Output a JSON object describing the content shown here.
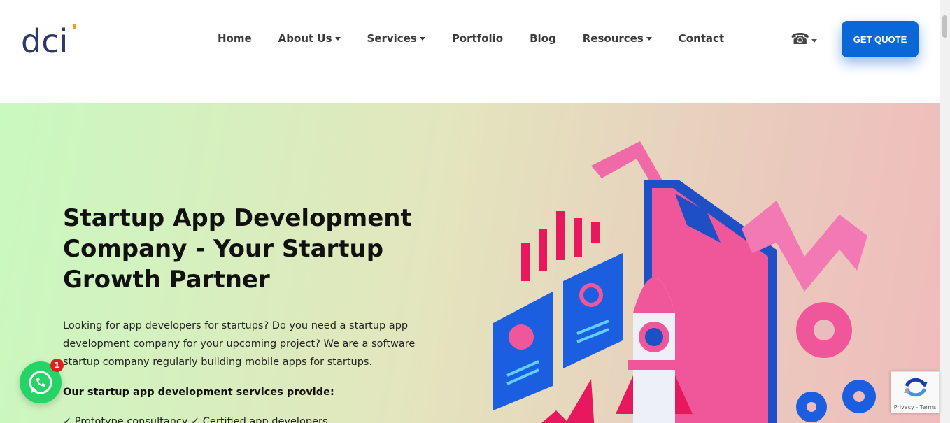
{
  "header": {
    "logo_text": "dci",
    "nav": [
      {
        "label": "Home",
        "has_dropdown": false
      },
      {
        "label": "About Us",
        "has_dropdown": true
      },
      {
        "label": "Services",
        "has_dropdown": true
      },
      {
        "label": "Portfolio",
        "has_dropdown": false
      },
      {
        "label": "Blog",
        "has_dropdown": false
      },
      {
        "label": "Resources",
        "has_dropdown": true
      },
      {
        "label": "Contact",
        "has_dropdown": false
      }
    ],
    "phone_icon": "telephone-icon",
    "cta_label": "GET QUOTE"
  },
  "hero": {
    "title": "Startup App Development Company - Your Startup Growth Partner",
    "description": "Looking for app developers for startups? Do you need a startup app development company for your upcoming project? We are a software startup company regularly building mobile apps for startups.",
    "subheading": "Our startup app development services provide:",
    "list_partial": "✓ Prototype consultancy   ✓ Certified app developers"
  },
  "widgets": {
    "whatsapp_badge": "1",
    "recaptcha_text": "Privacy - Terms"
  },
  "colors": {
    "accent": "#0a67d8",
    "logo_dark": "#2b3a6b",
    "logo_orange": "#f39c23",
    "whatsapp": "#25d366"
  }
}
